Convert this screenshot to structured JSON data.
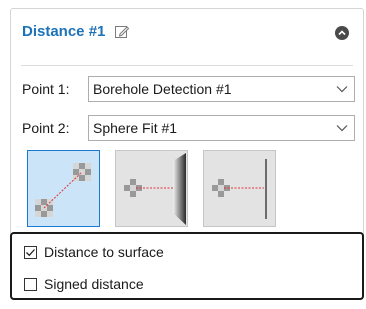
{
  "header": {
    "title": "Distance #1"
  },
  "point1": {
    "label": "Point 1:",
    "value": "Borehole Detection #1"
  },
  "point2": {
    "label": "Point 2:",
    "value": "Sphere Fit #1"
  },
  "modes": [
    {
      "name": "point-to-point",
      "selected": true
    },
    {
      "name": "point-to-plane",
      "selected": false
    },
    {
      "name": "point-to-line",
      "selected": false
    }
  ],
  "options": {
    "distance_to_surface": {
      "label": "Distance to surface",
      "checked": true
    },
    "signed_distance": {
      "label": "Signed distance",
      "checked": false
    }
  },
  "colors": {
    "title": "#1d73b8",
    "selected_bg": "#cce4f7",
    "selected_border": "#1c7bd0",
    "measure_line": "#e0303a"
  }
}
